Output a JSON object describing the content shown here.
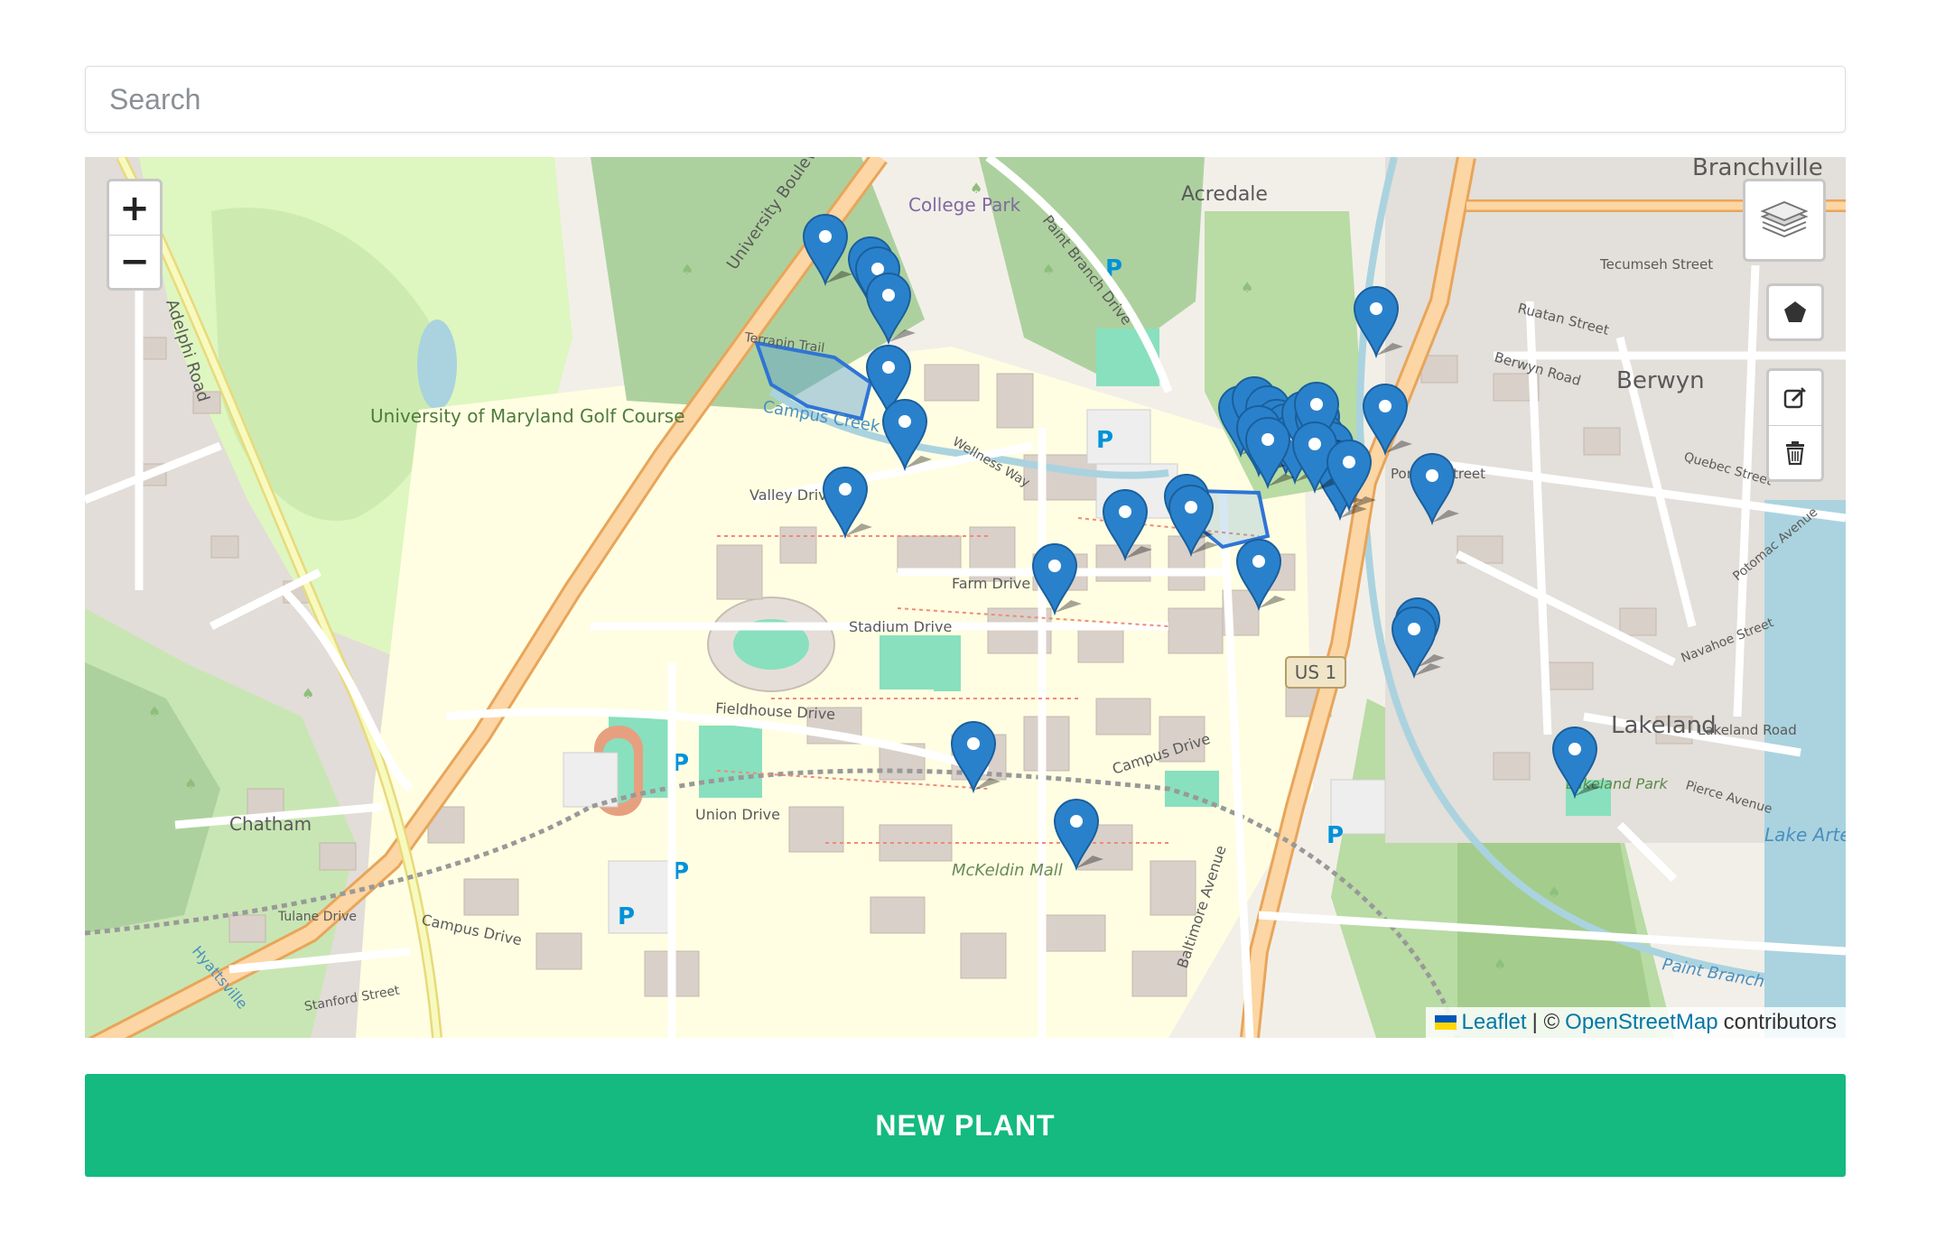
{
  "search": {
    "placeholder": "Search",
    "value": ""
  },
  "map": {
    "zoom_in_label": "+",
    "zoom_out_label": "−",
    "layers_icon": "layers-icon",
    "draw_polygon_icon": "pentagon-icon",
    "edit_icon": "edit-icon",
    "delete_icon": "trash-icon",
    "marker_icon": "map-pin-icon",
    "marker_color": "#2a81cb",
    "marker_count": 34,
    "attribution": {
      "leaflet": "Leaflet",
      "separator": "| ©",
      "osm": "OpenStreetMap",
      "suffix": "contributors"
    },
    "labels": {
      "branchville": "Branchville",
      "acredale": "Acredale",
      "college_park": "College Park",
      "paint_branch_drive": "Paint Branch Drive",
      "university_blvd": "University Boulevard",
      "terrapin_trail": "Terrapin Trail",
      "campus_creek": "Campus Creek",
      "wellness_way": "Wellness Way",
      "valley_drive": "Valley Drive",
      "farm_drive": "Farm Drive",
      "stadium_drive": "Stadium Drive",
      "fieldhouse_drive": "Fieldhouse Drive",
      "campus_drive": "Campus Drive",
      "union_drive": "Union Drive",
      "mckeldin_mall": "McKeldin Mall",
      "baltimore_avenue": "Baltimore Avenue",
      "us1": "US 1",
      "golf_course": "University of Maryland Golf Course",
      "adelphi_road": "Adelphi Road",
      "chatham": "Chatham",
      "tulane_drive": "Tulane Drive",
      "stanford_street": "Stanford Street",
      "hyattsville": "Hyattsville",
      "berwyn": "Berwyn",
      "tecumseh_street": "Tecumseh Street",
      "ruatan_street": "Ruatan Street",
      "berwyn_road": "Berwyn Road",
      "pontiac_street": "Pontiac Street",
      "lakeland": "Lakeland",
      "lakeland_road": "Lakeland Road",
      "lakeland_park": "Lakeland Park",
      "pierce_avenue": "Pierce Avenue",
      "lake_artemesia": "Lake Arte Par",
      "paint_branch": "Paint Branch",
      "quebec_street": "Quebec Street",
      "potomac_avenue": "Potomac Avenue",
      "navahoe_street": "Navahoe Street"
    }
  },
  "button": {
    "label": "NEW PLANT",
    "color": "#14ba80"
  },
  "colors": {
    "map_base": "#f2efe9",
    "park": "#c8facc",
    "golf": "#def6c0",
    "wood": "#add19e",
    "main_road": "#fcd6a4",
    "main_road_casing": "#e8a55a",
    "water": "#aad3df",
    "building": "#d9d0c9",
    "campus": "#ffffe5",
    "sports": "#88e0be"
  }
}
